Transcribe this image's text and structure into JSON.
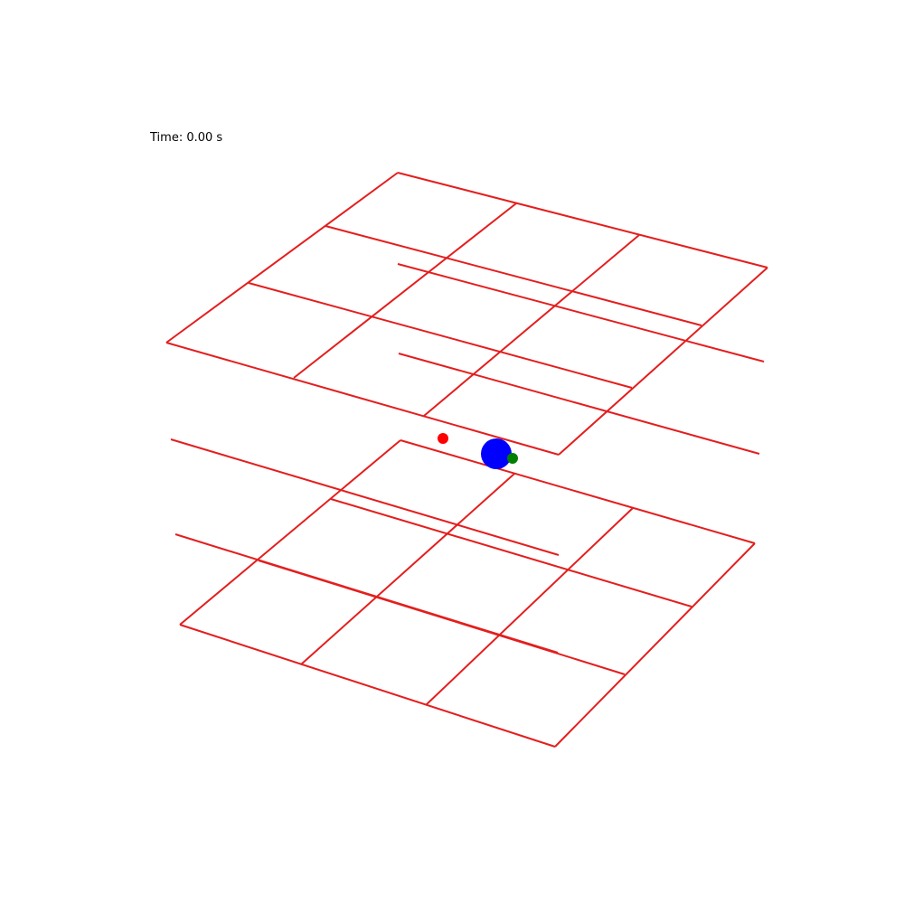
{
  "timer": {
    "text": "Time: 0.00 s"
  },
  "colors": {
    "grid": "#e41e1e",
    "large_body": "#0000ff",
    "small_body_left": "#ff0000",
    "small_body_right": "#008000"
  },
  "bodies": [
    {
      "name": "large-blue-sphere",
      "color_key": "large_body"
    },
    {
      "name": "small-red-sphere",
      "color_key": "small_body_left"
    },
    {
      "name": "small-green-sphere",
      "color_key": "small_body_right"
    }
  ]
}
